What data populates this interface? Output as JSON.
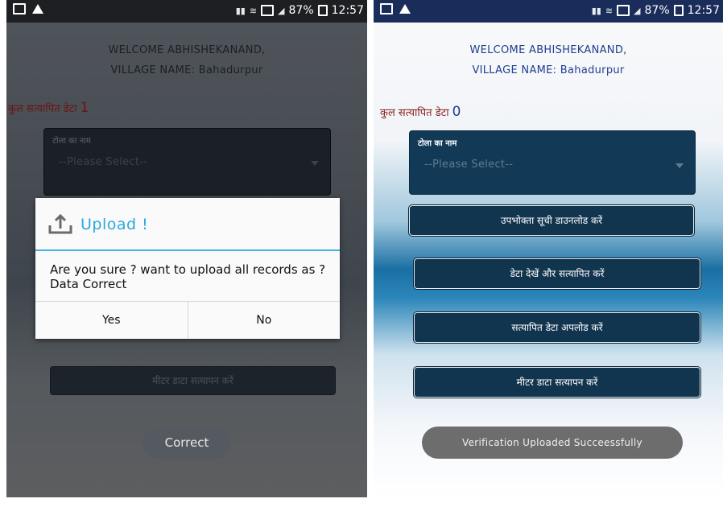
{
  "left": {
    "status": {
      "time": "12:57",
      "battery": "87%"
    },
    "welcome": "WELCOME ABHISHEKANAND,",
    "village": "VILLAGE NAME: Bahadurpur",
    "count_label": "कुल सत्यापित डेटा",
    "count_value": "1",
    "select_label": "टोला का नाम",
    "select_value": "--Please Select--",
    "meter_button": "मीटर डाटा सत्यापन करें",
    "correct_button": "Correct",
    "dialog": {
      "title": "Upload !",
      "message": "Are you sure ? want to upload all records as ?Data Correct",
      "yes": "Yes",
      "no": "No"
    }
  },
  "right": {
    "status": {
      "time": "12:57",
      "battery": "87%"
    },
    "welcome": "WELCOME ABHISHEKANAND,",
    "village": "VILLAGE NAME: Bahadurpur",
    "count_label": "कुल सत्यापित डेटा",
    "count_value": "0",
    "select_label": "टोला का नाम",
    "select_value": "--Please Select--",
    "buttons": [
      "उपभोक्ता सूची डाउनलोड करें",
      "डेटा देखें और सत्यापित करें",
      "सत्यापित डेटा अपलोड करें",
      "मीटर डाटा सत्यापन करें"
    ],
    "toast": "Verification Uploaded Succeessfully"
  }
}
